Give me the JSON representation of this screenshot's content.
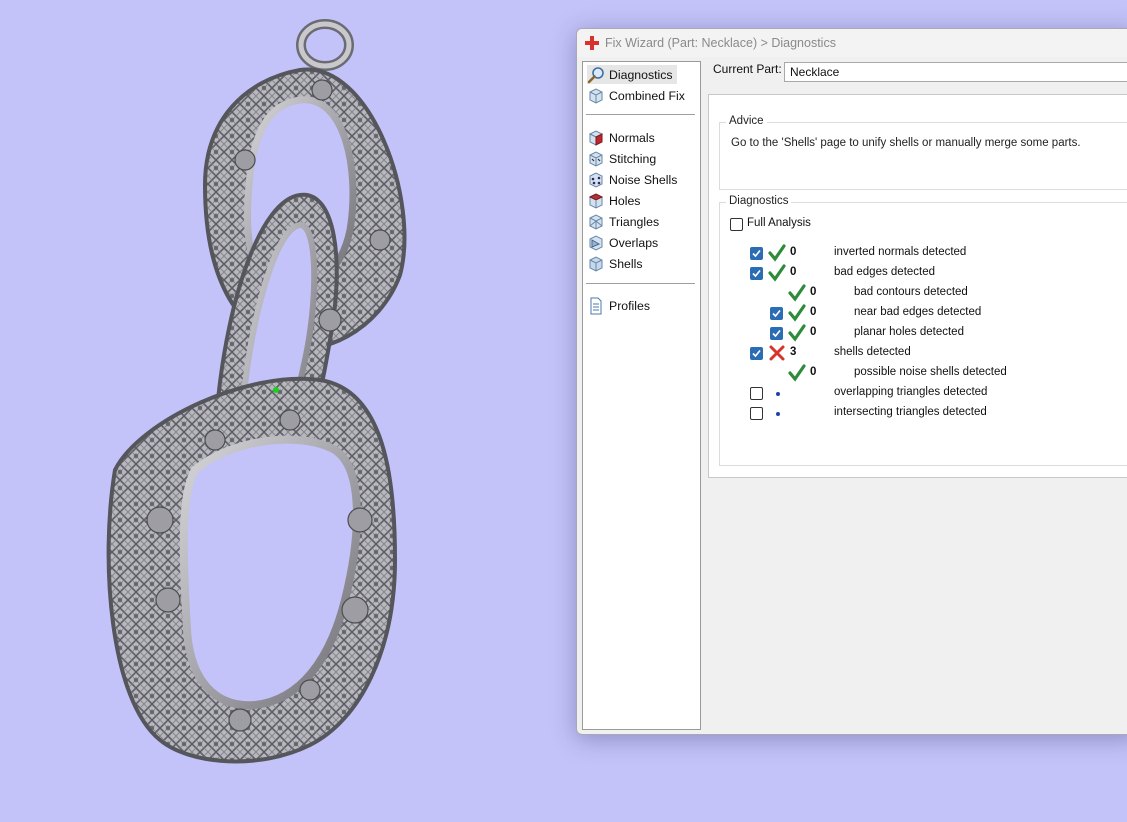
{
  "window": {
    "title": "Fix Wizard (Part: Necklace) > Diagnostics",
    "icon": "red-cross-icon"
  },
  "nav": {
    "items": [
      {
        "label": "Diagnostics",
        "icon": "magnifier-icon",
        "selected": true
      },
      {
        "label": "Combined Fix",
        "icon": "cube-icon"
      },
      {
        "label": "Normals",
        "icon": "cube-red-face-icon"
      },
      {
        "label": "Stitching",
        "icon": "cube-stitch-icon"
      },
      {
        "label": "Noise Shells",
        "icon": "cube-dots-icon"
      },
      {
        "label": "Holes",
        "icon": "cube-hole-icon"
      },
      {
        "label": "Triangles",
        "icon": "cube-triangles-icon"
      },
      {
        "label": "Overlaps",
        "icon": "cube-overlap-icon"
      },
      {
        "label": "Shells",
        "icon": "cube-shells-icon"
      },
      {
        "label": "Profiles",
        "icon": "document-icon"
      }
    ]
  },
  "current_part": {
    "label": "Current Part:",
    "value": "Necklace"
  },
  "advice": {
    "title": "Advice",
    "text": "Go to the 'Shells' page to unify shells or manually merge some parts."
  },
  "diagnostics": {
    "title": "Diagnostics",
    "full_analysis_label": "Full Analysis",
    "full_analysis_checked": false,
    "rows": [
      {
        "checkbox": true,
        "checked": true,
        "status": "ok",
        "count": "0",
        "label": "inverted normals detected",
        "indent": 0
      },
      {
        "checkbox": true,
        "checked": true,
        "status": "ok",
        "count": "0",
        "label": "bad edges detected",
        "indent": 0
      },
      {
        "checkbox": false,
        "checked": false,
        "status": "ok",
        "count": "0",
        "label": "bad contours detected",
        "indent": 1
      },
      {
        "checkbox": true,
        "checked": true,
        "status": "ok",
        "count": "0",
        "label": "near bad edges detected",
        "indent": 1
      },
      {
        "checkbox": true,
        "checked": true,
        "status": "ok",
        "count": "0",
        "label": "planar holes detected",
        "indent": 1
      },
      {
        "checkbox": true,
        "checked": true,
        "status": "error",
        "count": "3",
        "label": "shells detected",
        "indent": 0
      },
      {
        "checkbox": false,
        "checked": false,
        "status": "ok",
        "count": "0",
        "label": "possible noise shells detected",
        "indent": 1
      },
      {
        "checkbox": true,
        "checked": false,
        "status": "none",
        "count": "",
        "label": "overlapping triangles detected",
        "indent": 0
      },
      {
        "checkbox": true,
        "checked": false,
        "status": "none",
        "count": "",
        "label": "intersecting triangles detected",
        "indent": 0
      }
    ]
  },
  "colors": {
    "background": "#c3c3f9",
    "ok": "#2e8b3a",
    "error": "#d8332a",
    "checkbox": "#2b6db5"
  }
}
